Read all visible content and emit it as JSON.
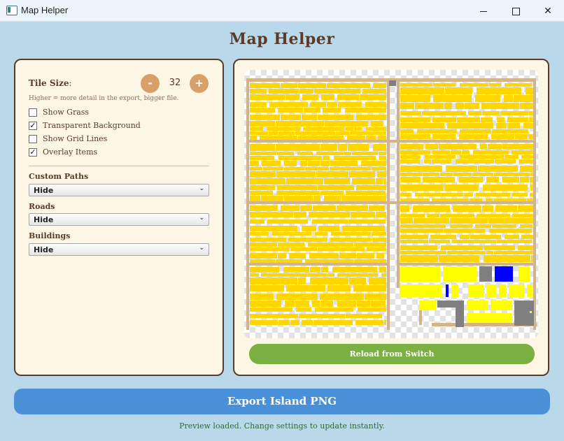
{
  "window": {
    "title": "Map Helper",
    "controls": [
      "minimize",
      "maximize",
      "close"
    ],
    "close_glyph": "✕"
  },
  "app_title": "Map Helper",
  "settings": {
    "tile_size_label": "Tile Size",
    "tile_size_colon": ":",
    "tile_size_value": "32",
    "decrement_label": "-",
    "increment_label": "+",
    "hint": "Higher = more detail in the export, bigger file.",
    "checkboxes": [
      {
        "label": "Show Grass",
        "checked": false,
        "mark": ""
      },
      {
        "label": "Transparent Background",
        "checked": true,
        "mark": "✓"
      },
      {
        "label": "Show Grid Lines",
        "checked": false,
        "mark": ""
      },
      {
        "label": "Overlay Items",
        "checked": true,
        "mark": "✓"
      }
    ],
    "custom_paths": {
      "label": "Custom Paths",
      "value": "Hide"
    },
    "roads": {
      "label": "Roads",
      "value": "Hide"
    },
    "buildings": {
      "label": "Buildings",
      "value": "Hide"
    },
    "chevron": "⌄"
  },
  "preview": {
    "reload_label": "Reload from Switch"
  },
  "export_label": "Export Island PNG",
  "status": "Preview loaded. Change settings to update instantly.",
  "colors": {
    "background": "#b9d9ea",
    "panel": "#fdf6e4",
    "border": "#5a3b29",
    "accent_round": "#d7a069",
    "reload": "#7bb043",
    "export": "#4a90d9",
    "status_text": "#2e6b34",
    "map_item": "#ffd700",
    "map_path": "#d2b48c",
    "map_building": "#808080",
    "map_blue": "#0000ff"
  }
}
